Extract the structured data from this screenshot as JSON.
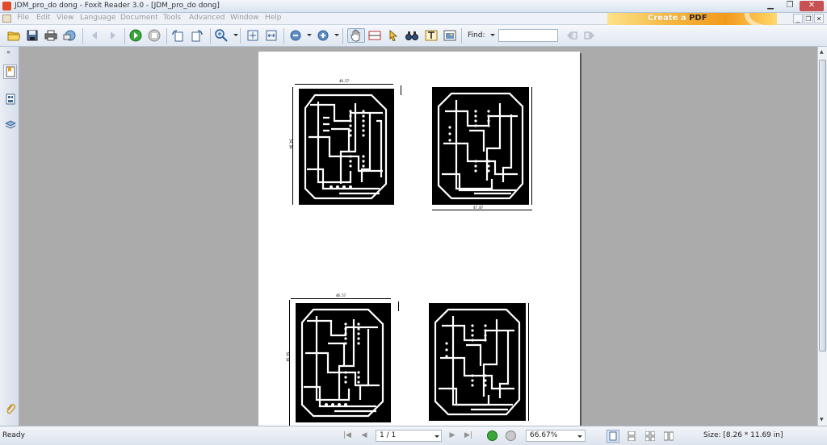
{
  "window": {
    "title": "JDM_pro_do dong - Foxit Reader 3.0 - [JDM_pro_do dong]",
    "minimize": "▁",
    "maximize": "❐",
    "close": "✕"
  },
  "menu": {
    "items": [
      "File",
      "Edit",
      "View",
      "Language",
      "Document",
      "Tools",
      "Advanced",
      "Window",
      "Help"
    ],
    "mdi_buttons": [
      "_",
      "❐",
      "✕"
    ]
  },
  "promo": {
    "create": "Create a",
    "pdf": "PDF"
  },
  "toolbar": {
    "find_label": "Find:",
    "find_value": ""
  },
  "document": {
    "boards": [
      {
        "dim_top": "48.57",
        "dim_side": "54.94"
      },
      {
        "dim_bottom": "47.87",
        "dim_side": "54.94"
      },
      {
        "dim_top": "48.57",
        "dim_side": "54.94"
      },
      {
        "dim_side": "54.94"
      }
    ]
  },
  "status": {
    "ready": "Ready",
    "page_indicator": "1 / 1",
    "zoom": "66.67%",
    "size": "Size: [8.26 * 11.69 in]"
  },
  "colors": {
    "accent_green": "#3aa63a",
    "titlebar": "#d9e4f1",
    "workspace": "#ababab",
    "pcb": "#000000"
  }
}
